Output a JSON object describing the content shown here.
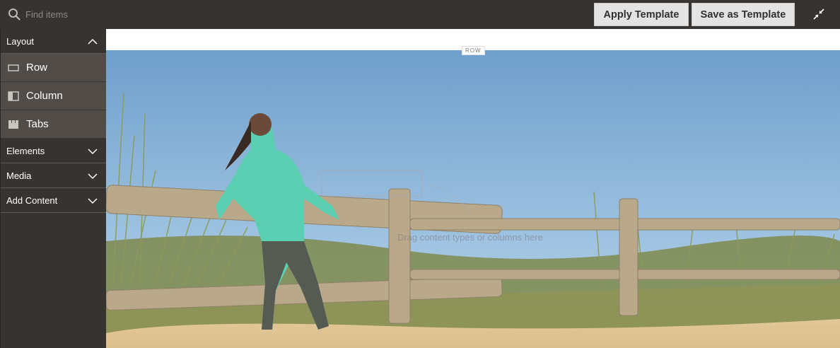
{
  "toolbar": {
    "search_placeholder": "Find items",
    "apply_label": "Apply Template",
    "save_label": "Save as Template"
  },
  "sidebar": {
    "layout_label": "Layout",
    "layout_items": [
      {
        "label": "Row",
        "icon": "row-icon"
      },
      {
        "label": "Column",
        "icon": "column-icon"
      },
      {
        "label": "Tabs",
        "icon": "tabs-icon"
      }
    ],
    "sections": [
      {
        "label": "Elements"
      },
      {
        "label": "Media"
      },
      {
        "label": "Add Content"
      }
    ]
  },
  "stage": {
    "row_label": "ROW",
    "drop_hint": "Drag content types or columns here"
  },
  "colors": {
    "panel": "#373330",
    "item": "#514c48",
    "button": "#e3e3e3"
  }
}
